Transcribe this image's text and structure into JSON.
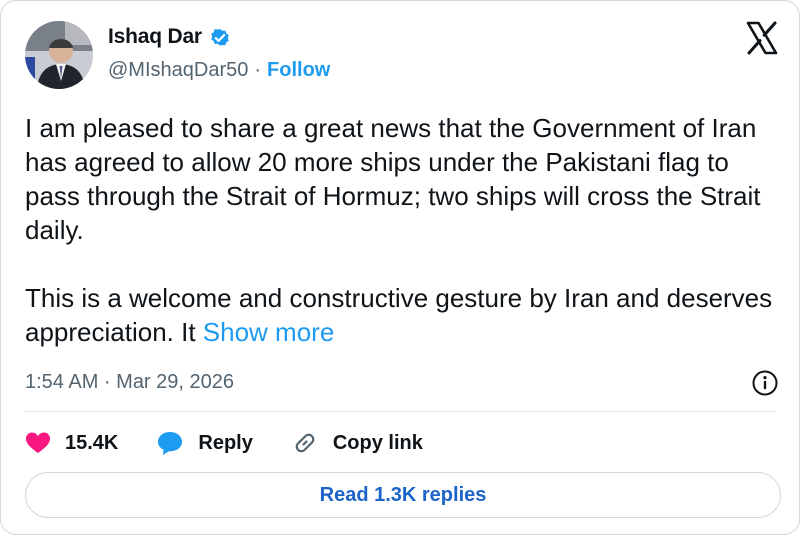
{
  "author": {
    "display_name": "Ishaq Dar",
    "handle": "@MIshaqDar50",
    "separator": "·",
    "follow_label": "Follow",
    "verified_color": "#1d9bf0"
  },
  "tweet": {
    "paragraph1": "I am pleased to share a great news that the Government of Iran has agreed to allow 20 more ships under the Pakistani flag to pass through the Strait of Hormuz; two ships will cross the Strait daily.",
    "paragraph2_text": "This is a welcome and constructive gesture by Iran and deserves appreciation. It ",
    "show_more": "Show more",
    "timestamp": "1:54 AM · Mar 29, 2026"
  },
  "actions": {
    "likes": "15.4K",
    "reply_label": "Reply",
    "copy_link_label": "Copy link",
    "read_replies_label": "Read 1.3K replies"
  },
  "icons": {
    "like": "heart-icon",
    "reply": "speech-bubble-icon",
    "copy": "link-icon",
    "info": "info-icon",
    "brand": "x-logo-icon"
  },
  "colors": {
    "accent": "#1d9bf0",
    "like": "#f91880",
    "text": "#0f1419",
    "muted": "#536471"
  }
}
